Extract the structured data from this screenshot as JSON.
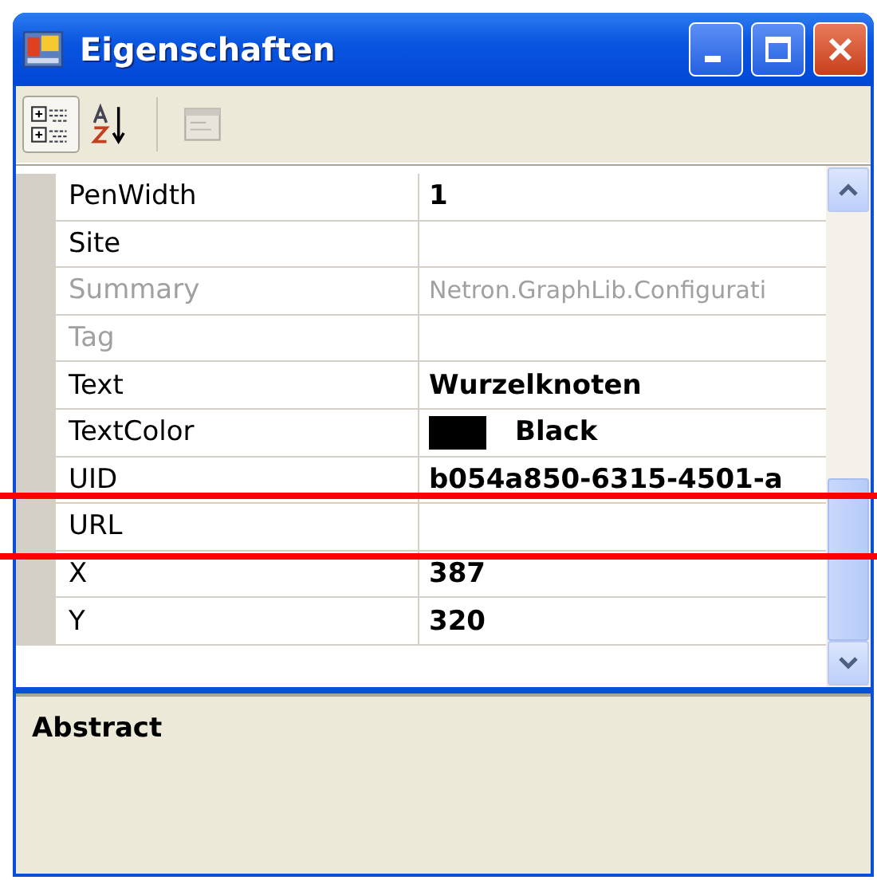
{
  "window": {
    "title": "Eigenschaften"
  },
  "toolbar": [
    {
      "kind": "categorized",
      "selected": true,
      "disabled": false
    },
    {
      "kind": "alphabetical",
      "selected": false,
      "disabled": false
    },
    {
      "kind": "pages",
      "selected": false,
      "disabled": true
    }
  ],
  "properties": [
    {
      "name": "PenWidth",
      "value": "1",
      "modified": true,
      "disabled": false
    },
    {
      "name": "Site",
      "disabled": false
    },
    {
      "name": "Summary",
      "value": "Netron.GraphLib.Configurati",
      "modified": false,
      "disabled": true
    },
    {
      "name": "Tag",
      "disabled": true
    },
    {
      "name": "Text",
      "value": "Wurzelknoten",
      "modified": true,
      "disabled": false
    },
    {
      "name": "TextColor",
      "value": "Black",
      "color": "#000000",
      "modified": true,
      "disabled": false
    },
    {
      "name": "UID",
      "value": "b054a850-6315-4501-a",
      "modified": true,
      "disabled": false
    },
    {
      "name": "URL",
      "disabled": false
    },
    {
      "name": "X",
      "value": "387",
      "modified": true,
      "disabled": false
    },
    {
      "name": "Y",
      "value": "320",
      "modified": true,
      "disabled": false
    }
  ],
  "description": {
    "title": "Abstract"
  }
}
